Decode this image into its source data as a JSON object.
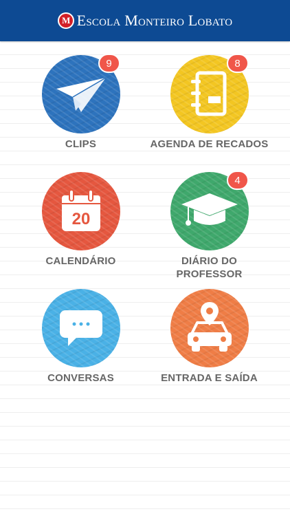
{
  "header": {
    "logo_letter": "M",
    "title": "Escola Monteiro Lobato"
  },
  "colors": {
    "header_bg": "#0d4a93",
    "badge": "#f0564a"
  },
  "tiles": [
    {
      "label_lines": [
        "CLIPS"
      ],
      "badge": "9",
      "color": "#2d73bd",
      "icon": "paper-plane-icon"
    },
    {
      "label_lines": [
        "AGENDA DE RECADOS"
      ],
      "badge": "8",
      "color": "#f3c622",
      "icon": "notebook-icon"
    },
    {
      "label_lines": [
        "CALENDÁRIO"
      ],
      "badge": "",
      "color": "#e5573f",
      "icon": "calendar-icon",
      "calendar_day": "20"
    },
    {
      "label_lines": [
        "DIÁRIO DO",
        "PROFESSOR"
      ],
      "badge": "4",
      "color": "#3fa86c",
      "icon": "graduation-cap-icon"
    },
    {
      "label_lines": [
        "CONVERSAS"
      ],
      "badge": "",
      "color": "#4ab1e6",
      "icon": "chat-bubble-icon"
    },
    {
      "label_lines": [
        "ENTRADA E SAÍDA"
      ],
      "badge": "",
      "color": "#ef7d46",
      "icon": "car-location-icon"
    }
  ]
}
